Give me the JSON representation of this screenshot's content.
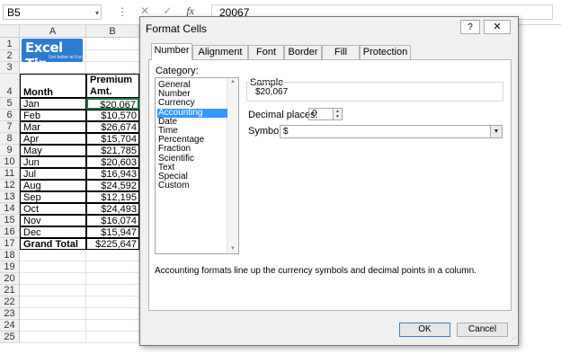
{
  "formula_bar": {
    "name_box": "B5",
    "name_dropdown_icon": "▾",
    "separator_icon": "⋮",
    "cancel_icon": "✕",
    "enter_icon": "✓",
    "fx_label": "fx",
    "value": "20067"
  },
  "sheet": {
    "columns": [
      "A",
      "B"
    ],
    "rows": [
      "1",
      "2",
      "3",
      "4",
      "5",
      "6",
      "7",
      "8",
      "9",
      "10",
      "11",
      "12",
      "13",
      "14",
      "15",
      "16",
      "17",
      "18",
      "19",
      "20",
      "21",
      "22",
      "23",
      "24",
      "25"
    ],
    "logo": {
      "text_main": "Excel",
      "text_tip": " Tip",
      "tagline": "Get better at Excel"
    },
    "header": {
      "month": "Month",
      "amount_line1": "Premium",
      "amount_line2": "Amt."
    },
    "data": [
      {
        "month": "Jan",
        "amount": "$20,067"
      },
      {
        "month": "Feb",
        "amount": "$10,570"
      },
      {
        "month": "Mar",
        "amount": "$26,674"
      },
      {
        "month": "Apr",
        "amount": "$15,704"
      },
      {
        "month": "May",
        "amount": "$21,785"
      },
      {
        "month": "Jun",
        "amount": "$20,603"
      },
      {
        "month": "Jul",
        "amount": "$16,943"
      },
      {
        "month": "Aug",
        "amount": "$24,592"
      },
      {
        "month": "Sep",
        "amount": "$12,195"
      },
      {
        "month": "Oct",
        "amount": "$24,493"
      },
      {
        "month": "Nov",
        "amount": "$16,074"
      },
      {
        "month": "Dec",
        "amount": "$15,947"
      }
    ],
    "total": {
      "label": "Grand Total",
      "amount": "$225,647"
    }
  },
  "dialog": {
    "title": "Format Cells",
    "help_label": "?",
    "close_label": "✕",
    "tabs": [
      "Number",
      "Alignment",
      "Font",
      "Border",
      "Fill",
      "Protection"
    ],
    "active_tab": "Number",
    "category_label": "Category:",
    "categories": [
      "General",
      "Number",
      "Currency",
      "Accounting",
      "Date",
      "Time",
      "Percentage",
      "Fraction",
      "Scientific",
      "Text",
      "Special",
      "Custom"
    ],
    "selected_category": "Accounting",
    "sample_label": "Sample",
    "sample_value": "$20,067",
    "decimal_label": "Decimal places:",
    "decimal_value": "0",
    "symbol_label": "Symbol:",
    "symbol_value": "$",
    "description": "Accounting formats line up the currency symbols and decimal points in a column.",
    "ok_label": "OK",
    "cancel_label": "Cancel"
  }
}
